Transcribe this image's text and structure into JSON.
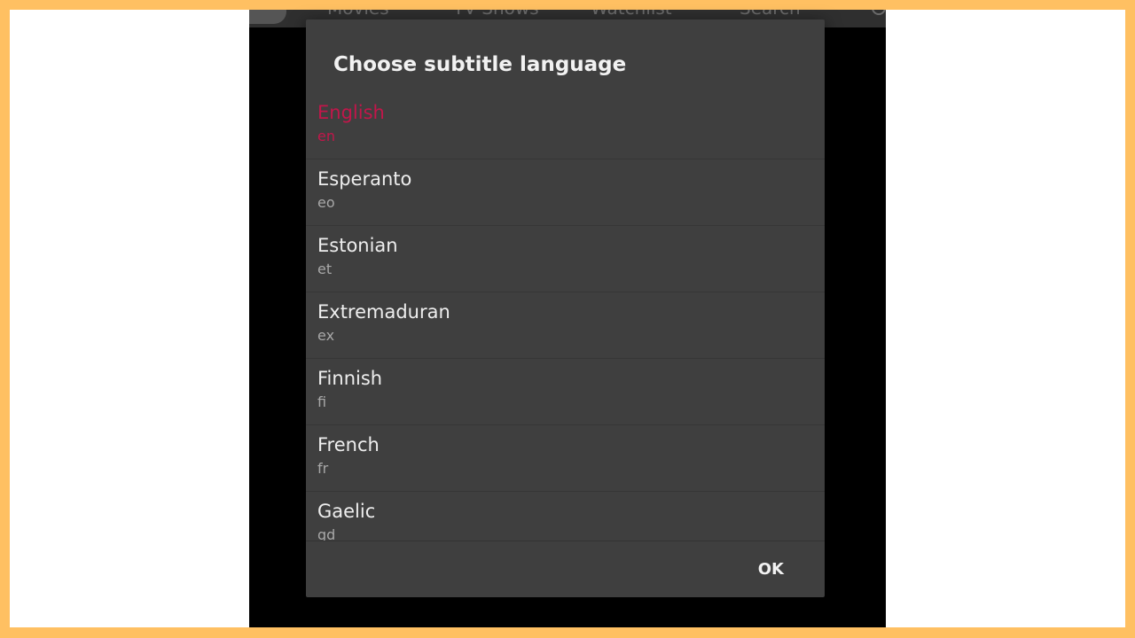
{
  "background_nav": {
    "items": [
      "Movies",
      "TV Shows",
      "Watchlist",
      "Search"
    ]
  },
  "dialog": {
    "title": "Choose subtitle language",
    "ok_label": "OK",
    "selected_color": "#c2164a",
    "languages": [
      {
        "name": "English",
        "code": "en",
        "selected": true
      },
      {
        "name": "Esperanto",
        "code": "eo",
        "selected": false
      },
      {
        "name": "Estonian",
        "code": "et",
        "selected": false
      },
      {
        "name": "Extremaduran",
        "code": "ex",
        "selected": false
      },
      {
        "name": "Finnish",
        "code": "fi",
        "selected": false
      },
      {
        "name": "French",
        "code": "fr",
        "selected": false
      },
      {
        "name": "Gaelic",
        "code": "gd",
        "selected": false
      }
    ]
  }
}
